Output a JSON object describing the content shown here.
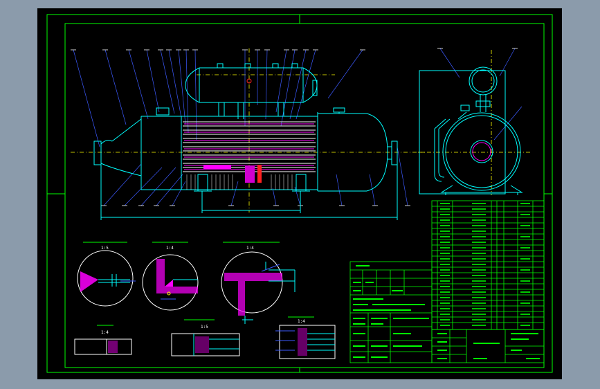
{
  "colors": {
    "background": "#8b9bab",
    "sheet": "#000000",
    "frame": "#00ff00",
    "vessel": "#00ffff",
    "leader": "#3c5aff",
    "centerline": "#ffff00",
    "magenta": "#ff00ff",
    "red": "#ff2020",
    "white": "#ffffff"
  },
  "drawing": {
    "scale_labels": [
      "1:5",
      "1:4",
      "1:4",
      "1:4",
      "1:5",
      "1:4"
    ]
  }
}
